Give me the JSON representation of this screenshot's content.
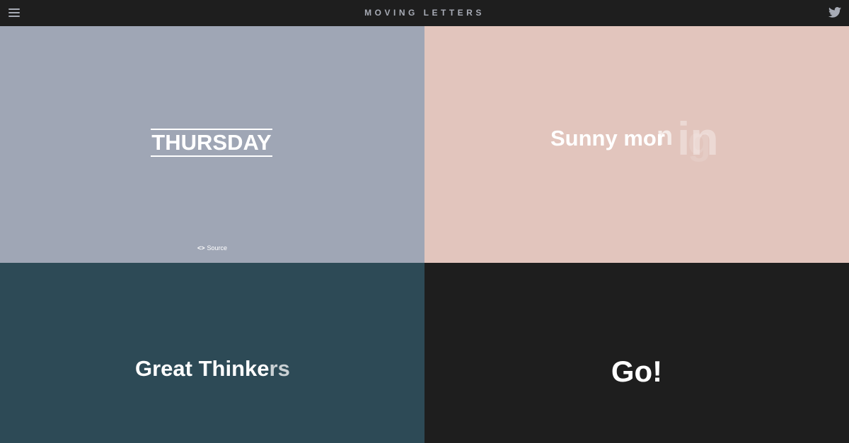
{
  "header": {
    "title": "MOVING LETTERS",
    "menu_icon": "hamburger-menu-icon",
    "twitter_icon": "twitter-bird-icon"
  },
  "colors": {
    "topbar": "#1e1e1e",
    "panel_thursday": "#9fa6b5",
    "panel_sunny": "#e2c5bd",
    "panel_thinkers": "#2d4a56",
    "panel_go": "#1e1e1e"
  },
  "panels": [
    {
      "text": "THURSDAY",
      "source_label": "Source"
    },
    {
      "text": "Sunny mor",
      "ghost_letters": [
        "n",
        "in",
        "g"
      ]
    },
    {
      "text": "Great Thinke",
      "faded_part": "rs"
    },
    {
      "text": "Go!"
    }
  ]
}
